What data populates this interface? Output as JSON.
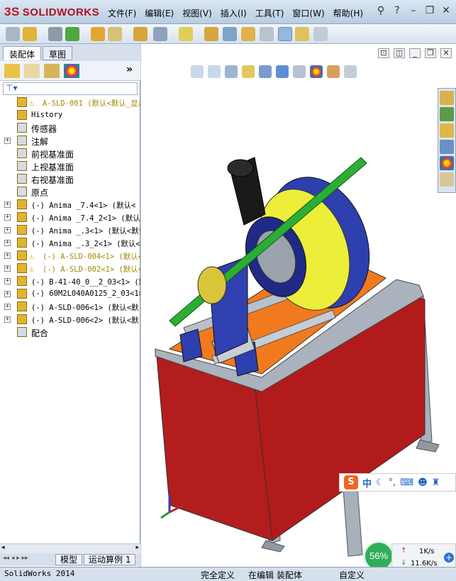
{
  "app": {
    "brand_ds": "3S",
    "brand_name": "SOLIDWORKS"
  },
  "menu": [
    "文件(F)",
    "编辑(E)",
    "视图(V)",
    "插入(I)",
    "工具(T)",
    "窗口(W)",
    "帮助(H)"
  ],
  "left_panel": {
    "tabs": [
      "装配体",
      "草图"
    ],
    "tree": [
      {
        "label": "A-SLD-001  (默认<默认_显示",
        "warn": true,
        "top_level": true
      },
      {
        "label": "History"
      },
      {
        "label": "传感器",
        "cn": true
      },
      {
        "label": "注解",
        "cn": true,
        "exp": true
      },
      {
        "label": "前视基准面",
        "cn": true
      },
      {
        "label": "上视基准面",
        "cn": true
      },
      {
        "label": "右视基准面",
        "cn": true
      },
      {
        "label": "原点",
        "cn": true
      },
      {
        "label": "(-) Anima _7.4<1> (默认<",
        "exp": true
      },
      {
        "label": "(-) Anima _7.4_2<1> (默认",
        "exp": true
      },
      {
        "label": "(-) Anima _.3<1> (默认<默认",
        "exp": true
      },
      {
        "label": "(-) Anima _.3_2<1> (默认<",
        "exp": true
      },
      {
        "label": "(-) A-SLD-004<1> (默认<",
        "exp": true,
        "warn": true
      },
      {
        "label": "(-) A-SLD-002<1> (默认<",
        "exp": true,
        "warn": true
      },
      {
        "label": "(-) B-41-40_0__2_03<1> (默",
        "exp": true
      },
      {
        "label": "(-) 60M2L040A0125_2_03<1>",
        "exp": true
      },
      {
        "label": "(-) A-SLD-006<1> (默认<默",
        "exp": true
      },
      {
        "label": "(-) A-SLD-006<2> (默认<默",
        "exp": true
      },
      {
        "label": "配合",
        "cn": true
      }
    ],
    "bottom_tabs": [
      "模型",
      "运动算例 1"
    ]
  },
  "status": {
    "app_version": "SolidWorks 2014",
    "state1": "完全定义",
    "state2": "在编辑 装配体",
    "state3": "自定义"
  },
  "ime": {
    "label": "中"
  },
  "network": {
    "percent": "56%",
    "up": "1K/s",
    "down": "11.6K/s"
  },
  "colors": {
    "machine_red": "#b31d1d",
    "machine_orange": "#f27a1e",
    "machine_yellow": "#ecee3a",
    "machine_blue": "#2e3fae",
    "shaft_green": "#2cae35",
    "frame_gray": "#aab3bd"
  }
}
